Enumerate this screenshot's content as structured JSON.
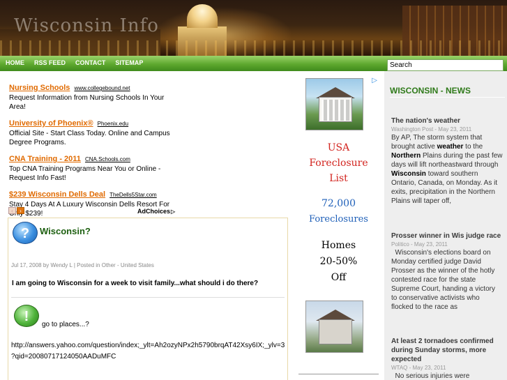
{
  "site": {
    "title": "Wisconsin Info"
  },
  "nav": {
    "items": [
      "HOME",
      "RSS FEED",
      "CONTACT",
      "SITEMAP"
    ]
  },
  "search": {
    "value": "Search"
  },
  "ads": [
    {
      "title": "Nursing Schools",
      "url": "www.collegebound.net",
      "desc": "Request Information from Nursing Schools In Your Area!"
    },
    {
      "title": "University of Phoenix®",
      "url": "Phoenix.edu",
      "desc": "Official Site - Start Class Today. Online and Campus Degree Programs."
    },
    {
      "title": "CNA Training - 2011",
      "url": "CNA.Schools.com",
      "desc": "Top CNA Training Programs Near You or Online - Request Info Fast!"
    },
    {
      "title": "$239 Wisconsin Dells Deal",
      "url": "TheDells5Star.com",
      "desc": "Stay 4 Days At A Luxury Wisconsin Dells Resort For Only $239!"
    }
  ],
  "ad_nav": {
    "prev": "‹",
    "next": "›",
    "adchoices": "AdChoices"
  },
  "article": {
    "title": "Wisconsin?",
    "meta": "Jul 17, 2008 by Wendy L | Posted in Other - United States",
    "question": "I am going to Wisconsin for a week to visit family...what should i do there?",
    "answer": "go to places...?",
    "link": "http://answers.yahoo.com/question/index;_ylt=Ah2ozyNPx2h5790brqAT42Xsy6IX;_ylv=3 ?qid=20080717124050AADuMFC",
    "q_icon": "question-mark-icon",
    "a_icon": "exclamation-icon"
  },
  "foreclosure_ad": {
    "line1": "USA",
    "line2": "Foreclosure",
    "line3": "List",
    "number": "72,000",
    "line4": "Foreclosures",
    "homes": "Homes",
    "pct": "20-50%",
    "off": "Off",
    "corner": "▷"
  },
  "news": {
    "heading": "WISCONSIN - NEWS",
    "items": [
      {
        "title": "The nation's weather",
        "meta": "Washington Post - May 23, 2011",
        "body_parts": [
          "By AP, The storm system that brought active ",
          "weather",
          " to the ",
          "Northern",
          " Plains during the past few days will lift northeastward through ",
          "Wisconsin",
          " toward southern Ontario, Canada, on Monday. As it exits, precipitation in the Northern Plains will taper off,"
        ]
      },
      {
        "title": "Prosser winner in Wis judge race",
        "meta": "Politico - May 23, 2011",
        "body": "  Wisconsin's elections board on Monday certified judge David Prosser as the winner of the hotly contested race for the state Supreme Court, handing a victory to conservative activists who flocked to the race as"
      },
      {
        "title": "At least 2 tornadoes confirmed during Sunday storms, more expected",
        "meta": "WTAQ - May 23, 2011",
        "body": "  No serious injuries were"
      }
    ]
  },
  "colors": {
    "nav_green": "#5ea82f",
    "ad_orange": "#e06a00",
    "news_green": "#2f7a1a",
    "fc_red": "#d2231e",
    "fc_blue": "#1e5fb8"
  }
}
